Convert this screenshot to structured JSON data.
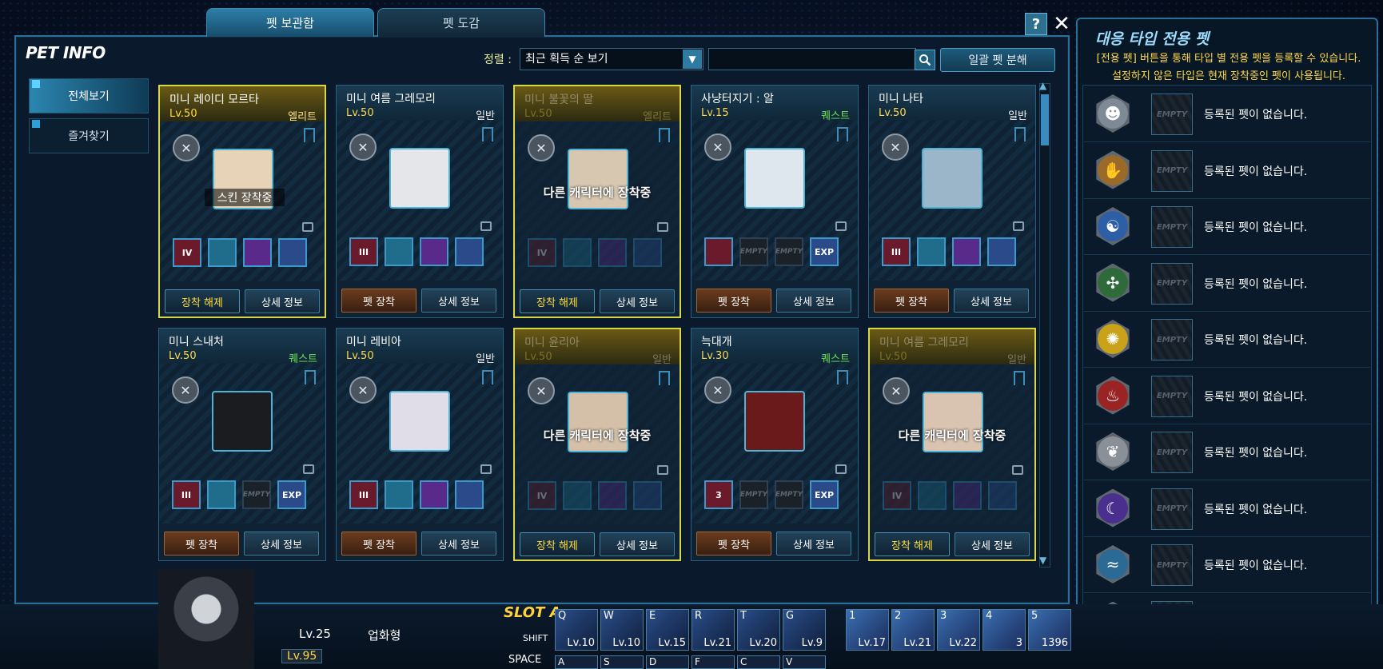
{
  "window": {
    "title": "PET INFO",
    "help_label": "?",
    "close_label": "✕"
  },
  "tabs": [
    {
      "label": "펫 보관함"
    },
    {
      "label": "펫 도감"
    }
  ],
  "sort": {
    "label": "정렬 :",
    "value": "최근 획득 순 보기",
    "bulk_label": "일괄 펫 분해"
  },
  "nav": [
    {
      "label": "전체보기"
    },
    {
      "label": "즐겨찾기"
    }
  ],
  "labels": {
    "equip": "펫 장착",
    "unequip": "장착 해제",
    "detail": "상세 정보",
    "equipped_other": "다른 캐릭터에 장착중",
    "skin_equipped": "스킨 장착중"
  },
  "pets": [
    {
      "name": "미니 레이디 모르타",
      "level": "Lv.50",
      "grade": "엘리트",
      "skills": [
        "IV",
        "",
        "",
        ""
      ]
    },
    {
      "name": "미니 여름 그레모리",
      "level": "Lv.50",
      "grade": "일반",
      "skills": [
        "III",
        "",
        "",
        ""
      ]
    },
    {
      "name": "미니 불꽃의 딸",
      "level": "Lv.50",
      "grade": "엘리트",
      "skills": [
        "IV",
        "",
        "",
        ""
      ]
    },
    {
      "name": "사냥터지기 : 알",
      "level": "Lv.15",
      "grade": "퀘스트",
      "skills": [
        "",
        "EMPTY",
        "EMPTY",
        "EXP"
      ]
    },
    {
      "name": "미니 나타",
      "level": "Lv.50",
      "grade": "일반",
      "skills": [
        "III",
        "",
        "",
        ""
      ]
    },
    {
      "name": "미니 스내처",
      "level": "Lv.50",
      "grade": "퀘스트",
      "skills": [
        "III",
        "",
        "EMPTY",
        "EXP"
      ]
    },
    {
      "name": "미니 레비아",
      "level": "Lv.50",
      "grade": "일반",
      "skills": [
        "III",
        "",
        "",
        ""
      ]
    },
    {
      "name": "미니 윤리아",
      "level": "Lv.50",
      "grade": "일반",
      "skills": [
        "IV",
        "",
        "",
        ""
      ]
    },
    {
      "name": "늑대개",
      "level": "Lv.30",
      "grade": "퀘스트",
      "skills": [
        "3",
        "EMPTY",
        "EMPTY",
        "EXP"
      ]
    },
    {
      "name": "미니 여름 그레모리",
      "level": "Lv.50",
      "grade": "일반",
      "skills": [
        "IV",
        "",
        "",
        ""
      ]
    }
  ],
  "right_panel": {
    "title": "대응 타입 전용 펫",
    "desc1": "[전용 펫] 버튼을 통해 타입 별 전용 펫을 등록할 수 있습니다.",
    "desc2": "설정하지 않은 타입은 현재 장착중인 펫이 사용됩니다.",
    "empty_label": "EMPTY",
    "no_pet": "등록된 펫이 없습니다.",
    "types": [
      {
        "icon": "mask-type-icon",
        "color": "#7e8a96"
      },
      {
        "icon": "claw-type-icon",
        "color": "#9a6a2a"
      },
      {
        "icon": "dragon-type-icon",
        "color": "#2d5fa6"
      },
      {
        "icon": "insect-type-icon",
        "color": "#2f6a3a"
      },
      {
        "icon": "gear-type-icon",
        "color": "#c9a21a"
      },
      {
        "icon": "fire-type-icon",
        "color": "#9a2424"
      },
      {
        "icon": "wing-type-icon",
        "color": "#8a9098"
      },
      {
        "icon": "ghost-type-icon",
        "color": "#4a2f8e"
      },
      {
        "icon": "water-type-icon",
        "color": "#2a6a94"
      },
      {
        "icon": "dna-type-icon",
        "color": "#2a6f86"
      }
    ]
  },
  "hud": {
    "pet_level": "Lv.25",
    "type_label": "업화형",
    "char_level": "Lv.95",
    "slot_label": "SLOT A",
    "shift_label": "SHIFT",
    "space_label": "SPACE",
    "hotkeys": [
      {
        "key": "Q",
        "level": "Lv.10"
      },
      {
        "key": "W",
        "level": "Lv.10"
      },
      {
        "key": "E",
        "level": "Lv.15"
      },
      {
        "key": "R",
        "level": "Lv.21"
      },
      {
        "key": "T",
        "level": "Lv.20"
      },
      {
        "key": "G",
        "level": "Lv.9"
      }
    ],
    "items": [
      {
        "key": "1",
        "level": "Lv.17"
      },
      {
        "key": "2",
        "level": "Lv.21"
      },
      {
        "key": "3",
        "level": "Lv.22"
      },
      {
        "key": "4",
        "level": "3"
      },
      {
        "key": "5",
        "level": "1396"
      }
    ],
    "lower_keys": [
      "A",
      "S",
      "D",
      "F",
      "C",
      "V"
    ]
  }
}
